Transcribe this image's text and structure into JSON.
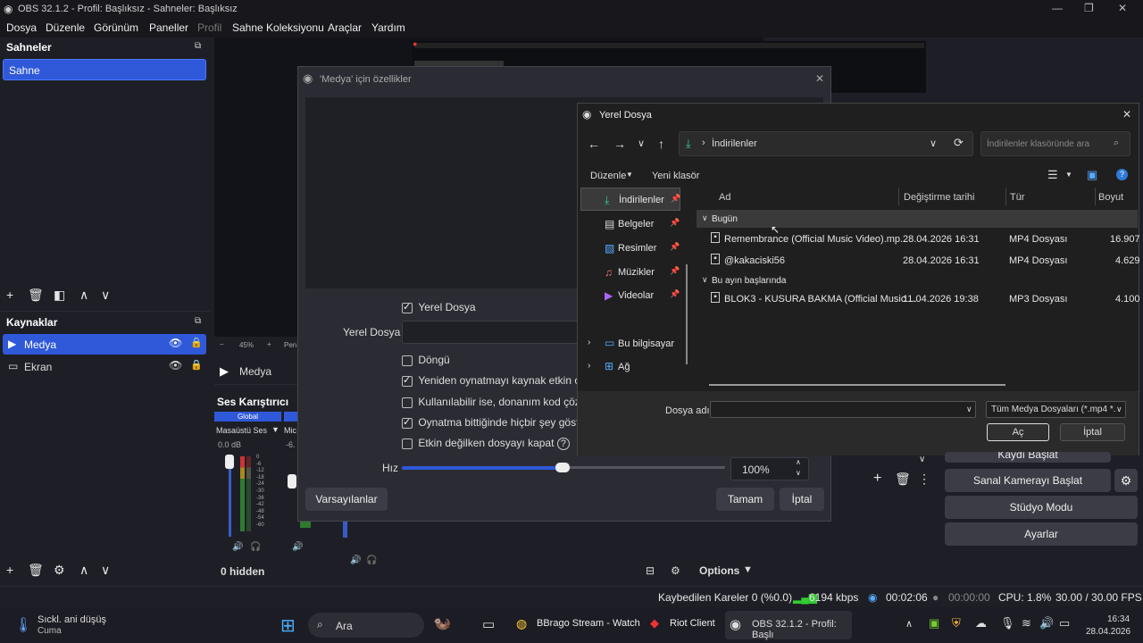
{
  "window": {
    "title": "OBS 32.1.2 - Profil: Başlıksız - Sahneler: Başlıksız"
  },
  "menu": [
    "Dosya",
    "Düzenle",
    "Görünüm",
    "Paneller",
    "Profil",
    "Sahne Koleksiyonu",
    "Araçlar",
    "Yardım"
  ],
  "scenes": {
    "title": "Sahneler",
    "items": [
      "Sahne"
    ]
  },
  "sources": {
    "title": "Kaynaklar",
    "items": [
      "Medya",
      "Ekran"
    ]
  },
  "preview": {
    "zoom": "45%",
    "media_label": "Medya",
    "small_label": "Pen"
  },
  "mixer": {
    "title": "Ses Karıştırıcı",
    "global": "Global",
    "ch1_name": "Masaüstü Ses",
    "ch1_db": "0.0 dB",
    "ch2_name": "Mic",
    "ch2_db": "-6.",
    "scale": [
      "0",
      "-6",
      "-12",
      "-18",
      "-24",
      "-30",
      "-36",
      "-42",
      "-48",
      "-54",
      "-60"
    ],
    "hidden": "0 hidden",
    "options": "Options"
  },
  "props": {
    "title": "'Medya' için özellikler",
    "local_file_cb": "Yerel Dosya",
    "local_file_label": "Yerel Dosya",
    "loop": "Döngü",
    "restart": "Yeniden oynatmayı kaynak etkin old",
    "hw": "Kullanılabilir ise, donanım kod çözm",
    "nothing": "Oynatma bittiğinde hiçbir şey göster",
    "close_inactive": "Etkin değilken dosyayı kapat",
    "speed_label": "Hız",
    "speed_value": "100%",
    "defaults": "Varsayılanlar",
    "ok": "Tamam",
    "cancel": "İptal"
  },
  "filedlg": {
    "title": "Yerel Dosya",
    "path": "İndirilenler",
    "search_placeholder": "İndirilenler klasöründe ara",
    "organize": "Düzenle",
    "new_folder": "Yeni klasör",
    "sidebar": [
      {
        "label": "İndirilenler",
        "icon": "download-icon",
        "pinned": true
      },
      {
        "label": "Belgeler",
        "icon": "document-icon",
        "pinned": true
      },
      {
        "label": "Resimler",
        "icon": "picture-icon",
        "pinned": true
      },
      {
        "label": "Müzikler",
        "icon": "music-icon",
        "pinned": true
      },
      {
        "label": "Videolar",
        "icon": "video-icon",
        "pinned": true
      }
    ],
    "sidebar2": [
      "Bu bilgisayar",
      "Ağ"
    ],
    "columns": [
      "Ad",
      "Değiştirme tarihi",
      "Tür",
      "Boyut"
    ],
    "group1": "Bugün",
    "group2": "Bu ayın başlarında",
    "files": [
      {
        "name": "Remembrance (Official Music Video).mp...",
        "date": "28.04.2026 16:31",
        "type": "MP4 Dosyası",
        "size": "16.907"
      },
      {
        "name": "@kakaciski56",
        "date": "28.04.2026 16:31",
        "type": "MP4 Dosyası",
        "size": "4.629"
      },
      {
        "name": "BLOK3 - KUSURA BAKMA (Official Music ...",
        "date": "11.04.2026 19:38",
        "type": "MP3 Dosyası",
        "size": "4.100"
      }
    ],
    "filename_label": "Dosya adı:",
    "filter": "Tüm Medya Dosyaları (*.mp4 *.",
    "open": "Aç",
    "cancel": "İptal"
  },
  "controls": {
    "record": "Kaydı Başlat",
    "virtualcam": "Sanal Kamerayı Başlat",
    "studio": "Stüdyo Modu",
    "settings": "Ayarlar"
  },
  "status": {
    "dropped": "Kaybedilen Kareler 0 (%0.0)",
    "kbps": "6194 kbps",
    "rec_time": "00:02:06",
    "stream_time": "00:00:00",
    "cpu": "CPU: 1.8%",
    "fps": "30.00 / 30.00 FPS"
  },
  "taskbar": {
    "weather_title": "Sıckl. ani düşüş",
    "weather_sub": "Cuma",
    "search": "Ara",
    "app1": "BBrago Stream - Watch",
    "app2": "Riot Client",
    "app3": "OBS 32.1.2 - Profil: Başlı",
    "time": "16:34",
    "date": "28.04.2026"
  },
  "colors": {
    "accent": "#2f59d9",
    "bg": "#1e1f26"
  }
}
